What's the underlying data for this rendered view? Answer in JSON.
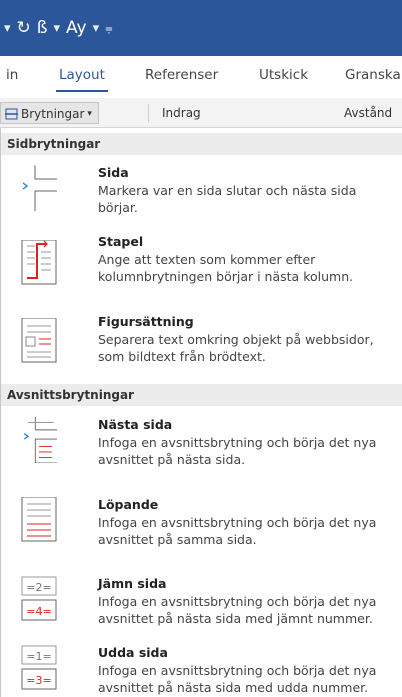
{
  "quick_access": {
    "icons": [
      "dropdown-icon",
      "redo-icon",
      "format-painter-icon",
      "spelling-icon",
      "customize-icon"
    ]
  },
  "tabs": [
    {
      "label": "in",
      "active": false
    },
    {
      "label": "Layout",
      "active": true
    },
    {
      "label": "Referenser",
      "active": false
    },
    {
      "label": "Utskick",
      "active": false
    },
    {
      "label": "Granska",
      "active": false
    }
  ],
  "ribbon": {
    "breaks_button": "Brytningar",
    "indent_label": "Indrag",
    "spacing_label": "Avstånd"
  },
  "menu": {
    "page_breaks_header": "Sidbrytningar",
    "section_breaks_header": "Avsnittsbrytningar",
    "items": [
      {
        "title": "Sida",
        "desc": "Markera var en sida slutar och nästa sida börjar."
      },
      {
        "title": "Stapel",
        "desc": "Ange att texten som kommer efter kolumnbrytningen börjar i nästa kolumn."
      },
      {
        "title": "Figursättning",
        "desc": "Separera text omkring objekt på webbsidor, som bildtext från brödtext."
      },
      {
        "title": "Nästa sida",
        "desc": "Infoga en avsnittsbrytning och börja det nya avsnittet på nästa sida."
      },
      {
        "title": "Löpande",
        "desc": "Infoga en avsnittsbrytning och börja det nya avsnittet på samma sida."
      },
      {
        "title": "Jämn sida",
        "desc": "Infoga en avsnittsbrytning och börja det nya avsnittet på nästa sida med jämnt nummer."
      },
      {
        "title": "Udda sida",
        "desc": "Infoga en avsnittsbrytning och börja det nya avsnittet på nästa sida med udda nummer."
      }
    ],
    "even_icon_numbers": [
      "2",
      "4"
    ],
    "odd_icon_numbers": [
      "1",
      "3"
    ]
  }
}
